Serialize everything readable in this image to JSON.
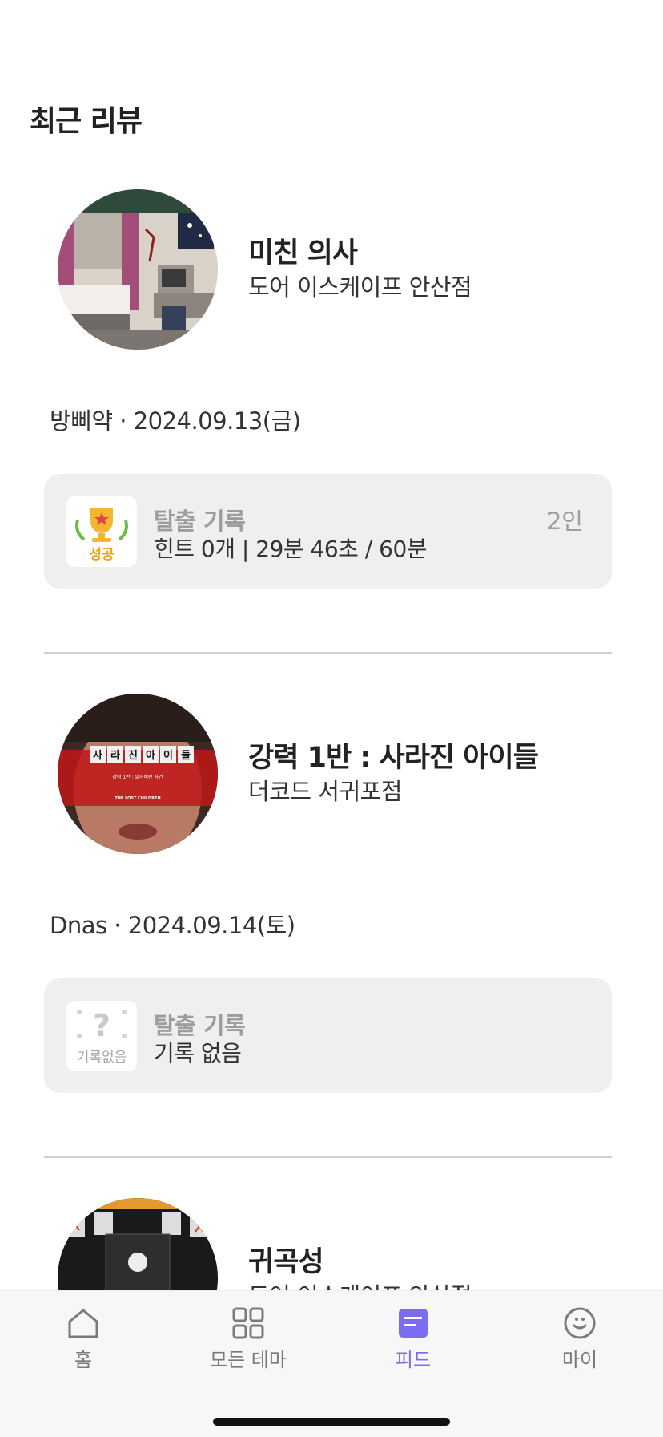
{
  "header": {
    "title": "최근 리뷰"
  },
  "reviews": [
    {
      "theme_name": "미친 의사",
      "cafe_name": "도어 이스케이프 안산점",
      "meta": "방삐약 · 2024.09.13(금)",
      "record": {
        "badge_label": "성공",
        "badge_icon": "trophy-icon",
        "title": "탈출 기록",
        "detail": "힌트 0개 | 29분 46초 / 60분",
        "people": "2인"
      }
    },
    {
      "theme_name": "강력 1반 : 사라진 아이들",
      "cafe_name": "더코드 서귀포점",
      "meta": "Dnas · 2024.09.14(토)",
      "poster_text": {
        "title_chars": [
          "사",
          "라",
          "진",
          "아",
          "이",
          "들"
        ],
        "subtitle": "강력 1반 : 잃어버린 사건",
        "english": "THE LOST CHILDREN"
      },
      "record": {
        "badge_label": "기록없음",
        "badge_icon": "question-icon",
        "title": "탈출 기록",
        "detail": "기록 없음",
        "people": ""
      }
    },
    {
      "theme_name": "귀곡성",
      "cafe_name": "도어 이스케이프 안산점"
    }
  ],
  "tabbar": {
    "items": [
      {
        "label": "홈",
        "icon": "home-icon",
        "active": false
      },
      {
        "label": "모든 테마",
        "icon": "grid-icon",
        "active": false
      },
      {
        "label": "피드",
        "icon": "feed-icon",
        "active": true
      },
      {
        "label": "마이",
        "icon": "smile-icon",
        "active": false
      }
    ]
  },
  "colors": {
    "accent": "#7b6cf0",
    "card_bg": "#efefef",
    "success": "#e8a317",
    "muted": "#9d9d9d"
  }
}
